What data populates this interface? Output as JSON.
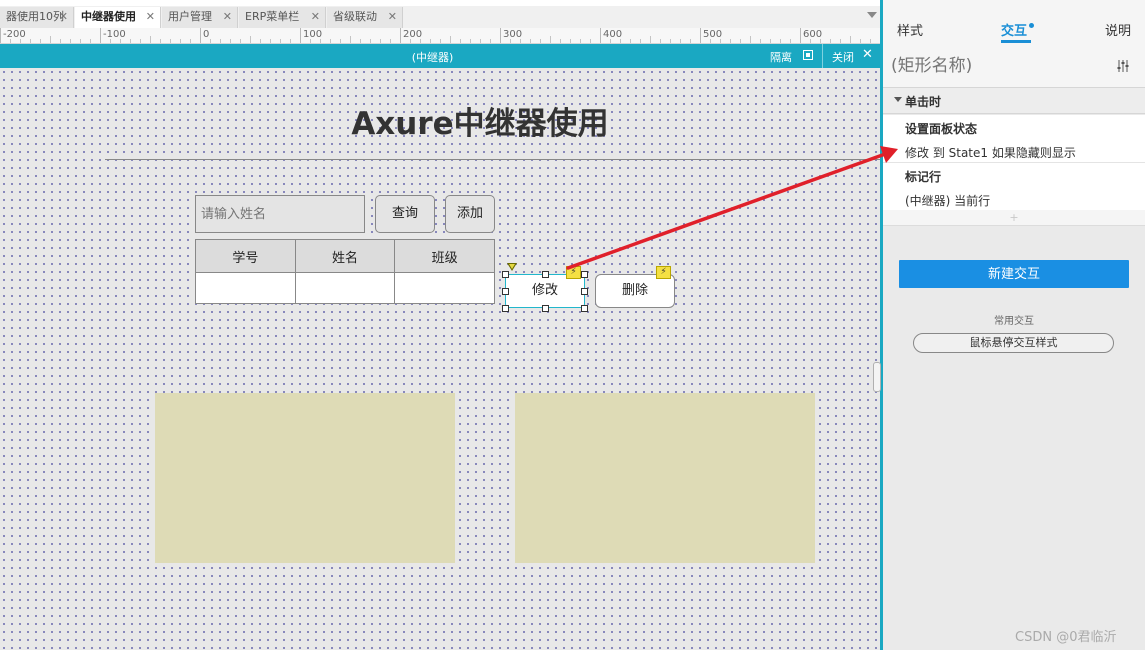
{
  "tabs": [
    {
      "label": "器使用10列",
      "active": false
    },
    {
      "label": "中继器使用",
      "active": true
    },
    {
      "label": "用户管理",
      "active": false
    },
    {
      "label": "ERP菜单栏",
      "active": false
    },
    {
      "label": "省级联动",
      "active": false
    }
  ],
  "tab_close_glyph": "✕",
  "ruler_labels": [
    "-200",
    "-100",
    "0",
    "100",
    "200",
    "300",
    "400",
    "500",
    "600"
  ],
  "repeater_bar": {
    "title": "(中继器)",
    "isolate_label": "隔离",
    "close_label": "关闭",
    "close_glyph": "✕"
  },
  "canvas": {
    "heading": "Axure中继器使用",
    "name_input_placeholder": "请输入姓名",
    "query_label": "查询",
    "add_label": "添加",
    "table_headers": [
      "学号",
      "姓名",
      "班级"
    ],
    "edit_label": "修改",
    "delete_label": "删除",
    "bolt_glyph": "⚡"
  },
  "right_panel": {
    "tabs": {
      "style": "样式",
      "interaction": "交互",
      "notes": "说明"
    },
    "shape_name_placeholder": "(矩形名称)",
    "event": "单击时",
    "actions": [
      {
        "name": "设置面板状态",
        "desc": "修改 到 State1 如果隐藏则显示"
      },
      {
        "name": "标记行",
        "desc": "(中继器) 当前行"
      }
    ],
    "add_action_glyph": "+",
    "new_interaction": "新建交互",
    "common_interactions": "常用交互",
    "hover_style": "鼠标悬停交互样式"
  },
  "watermark": "CSDN @0君临沂",
  "colors": {
    "accent_teal": "#1aa8c2",
    "accent_blue": "#1a8fe3",
    "annotation_arrow": "#e0202a",
    "panel_fill": "#dedbb6"
  },
  "icons": [
    "tab-close-icon",
    "dropdown-arrow-icon",
    "isolate-icon",
    "close-icon",
    "lightning-bolt-icon",
    "sliders-settings-icon",
    "collapse-caret-icon",
    "annotation-arrow"
  ]
}
